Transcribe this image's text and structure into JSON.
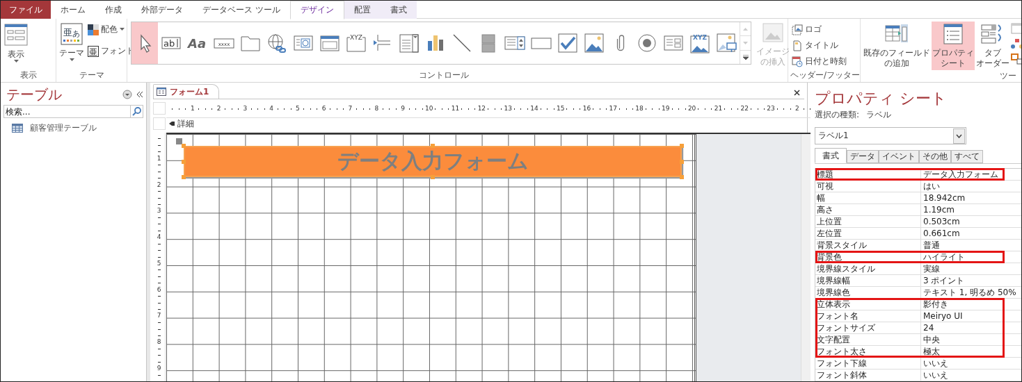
{
  "ribbon_tabs": [
    {
      "label": "ファイル",
      "kind": "file",
      "selected": false
    },
    {
      "label": "ホーム",
      "kind": "main",
      "selected": false
    },
    {
      "label": "作成",
      "kind": "main",
      "selected": false
    },
    {
      "label": "外部データ",
      "kind": "main",
      "selected": false
    },
    {
      "label": "データベース ツール",
      "kind": "main",
      "selected": false
    },
    {
      "label": "デザイン",
      "kind": "context",
      "selected": true
    },
    {
      "label": "配置",
      "kind": "context",
      "selected": false
    },
    {
      "label": "書式",
      "kind": "context",
      "selected": false
    }
  ],
  "ribbon": {
    "view_group": {
      "button": "表示",
      "label": "表示"
    },
    "theme_group": {
      "theme_button": "テーマ",
      "theme_glyph": "亜",
      "theme_glyph_small": "あ",
      "colors_button": "配色",
      "font_button": "フォント",
      "font_glyph": "亜",
      "label": "テーマ"
    },
    "controls_group": {
      "label": "コントロール",
      "gallery": [
        {
          "kind": "pointer",
          "selected": true
        },
        {
          "kind": "textbox",
          "glyph": "ab",
          "selected": false
        },
        {
          "kind": "label",
          "glyph": "Aa",
          "selected": false
        },
        {
          "kind": "button",
          "glyph": "xxxx",
          "selected": false
        },
        {
          "kind": "tab",
          "selected": false
        },
        {
          "kind": "hyperlink",
          "selected": false
        },
        {
          "kind": "webbrowser",
          "selected": false
        },
        {
          "kind": "navigation",
          "selected": false
        },
        {
          "kind": "optiongroup",
          "glyph": "XYZ",
          "selected": false
        },
        {
          "kind": "pagebreak",
          "selected": false
        },
        {
          "kind": "combobox",
          "selected": false
        },
        {
          "kind": "chart",
          "selected": false
        },
        {
          "kind": "line",
          "selected": false
        },
        {
          "kind": "toggle",
          "selected": false
        },
        {
          "kind": "listbox",
          "selected": false
        },
        {
          "kind": "rectangle",
          "selected": false
        },
        {
          "kind": "checkbox",
          "selected": false
        },
        {
          "kind": "image",
          "selected": false
        },
        {
          "kind": "attachment",
          "selected": false
        },
        {
          "kind": "optionbutton",
          "selected": false
        },
        {
          "kind": "subform",
          "selected": false
        },
        {
          "kind": "boundobject",
          "glyph": "XYZ",
          "selected": false
        },
        {
          "kind": "unboundobject",
          "selected": false
        }
      ],
      "insert_image": {
        "lines": [
          "イメージ",
          "の挿入"
        ],
        "disabled": true
      }
    },
    "header_footer_group": {
      "label": "ヘッダー/フッター",
      "buttons": [
        {
          "kind": "logo",
          "label": "ロゴ"
        },
        {
          "kind": "title",
          "label": "タイトル"
        },
        {
          "kind": "datetime",
          "label": "日付と時刻"
        }
      ]
    },
    "tools_group": {
      "label": "ツー",
      "buttons": [
        {
          "kind": "fields",
          "lines": [
            "既存のフィールド",
            "の追加"
          ],
          "selected": false
        },
        {
          "kind": "property",
          "lines": [
            "プロパティ",
            "シート"
          ],
          "selected": true
        },
        {
          "kind": "taborder",
          "lines": [
            "タブ",
            "オーダー"
          ],
          "selected": false
        }
      ]
    }
  },
  "navigation_pane": {
    "title": "テーブル",
    "search": {
      "placeholder": "検索..."
    },
    "items": [
      {
        "label": "顧客管理テーブル"
      }
    ]
  },
  "document": {
    "tab": "フォーム1",
    "ruler_marks": [
      "1",
      "2",
      "3",
      "4",
      "5",
      "6",
      "7",
      "8",
      "9",
      "10",
      "11",
      "12",
      "13",
      "14",
      "15",
      "16",
      "17",
      "18",
      "19",
      "20",
      "21",
      "22",
      "23",
      "2"
    ],
    "section": "詳細",
    "vertical_ruler_marks": [
      "1",
      "2",
      "3",
      "4",
      "5",
      "6",
      "7",
      "8",
      "9"
    ],
    "label_control": {
      "text": "データ入力フォーム",
      "selected": true
    }
  },
  "property_sheet": {
    "title": "プロパティ シート",
    "selection_type_label": "選択の種類:",
    "selection_type": "ラベル",
    "object": "ラベル1",
    "tabs": [
      {
        "label": "書式",
        "selected": true
      },
      {
        "label": "データ",
        "selected": false
      },
      {
        "label": "イベント",
        "selected": false
      },
      {
        "label": "その他",
        "selected": false
      },
      {
        "label": "すべて",
        "selected": false
      }
    ],
    "rows": [
      {
        "name": "標題",
        "value": "データ入力フォーム",
        "highlighted": true
      },
      {
        "name": "可視",
        "value": "はい",
        "highlighted": false
      },
      {
        "name": "幅",
        "value": "18.942cm",
        "highlighted": false
      },
      {
        "name": "高さ",
        "value": "1.19cm",
        "highlighted": false
      },
      {
        "name": "上位置",
        "value": "0.503cm",
        "highlighted": false
      },
      {
        "name": "左位置",
        "value": "0.661cm",
        "highlighted": false
      },
      {
        "name": "背景スタイル",
        "value": "普通",
        "highlighted": false
      },
      {
        "name": "背景色",
        "value": "ハイライト",
        "highlighted": true
      },
      {
        "name": "境界線スタイル",
        "value": "実線",
        "highlighted": false
      },
      {
        "name": "境界線幅",
        "value": "3 ポイント",
        "highlighted": false
      },
      {
        "name": "境界線色",
        "value": "テキスト 1, 明るめ 50%",
        "highlighted": false
      },
      {
        "name": "立体表示",
        "value": "影付き",
        "highlighted": true
      },
      {
        "name": "フォント名",
        "value": "Meiryo UI",
        "highlighted": true
      },
      {
        "name": "フォントサイズ",
        "value": "24",
        "highlighted": true
      },
      {
        "name": "文字配置",
        "value": "中央",
        "highlighted": true
      },
      {
        "name": "フォント太さ",
        "value": "極太",
        "highlighted": true
      },
      {
        "name": "フォント下線",
        "value": "いいえ",
        "highlighted": false
      },
      {
        "name": "フォント斜体",
        "value": "いいえ",
        "highlighted": false
      }
    ]
  }
}
